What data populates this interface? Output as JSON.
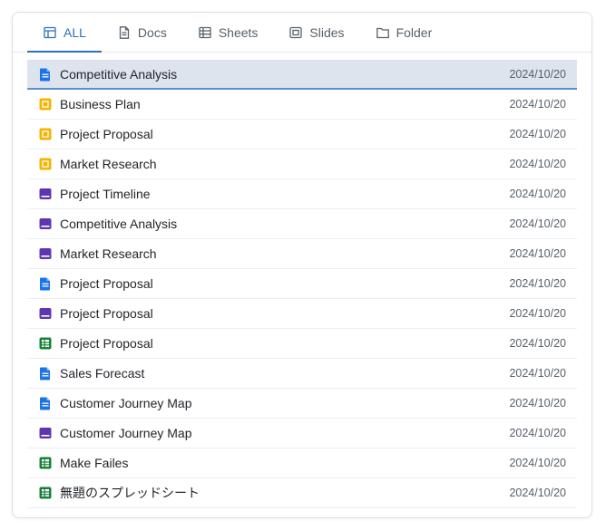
{
  "tabs": [
    {
      "label": "ALL",
      "icon": "layout-icon",
      "active": true
    },
    {
      "label": "Docs",
      "icon": "doc-icon",
      "active": false
    },
    {
      "label": "Sheets",
      "icon": "sheet-icon",
      "active": false
    },
    {
      "label": "Slides",
      "icon": "slides-icon",
      "active": false
    },
    {
      "label": "Folder",
      "icon": "folder-icon",
      "active": false
    }
  ],
  "colors": {
    "accent": "#2c6fbf",
    "doc": "#1a73e8",
    "slides": "#f4b400",
    "purple": "#5e35b1",
    "sheet": "#188038"
  },
  "files": [
    {
      "name": "Competitive Analysis",
      "date": "2024/10/20",
      "type": "doc",
      "selected": true
    },
    {
      "name": "Business Plan",
      "date": "2024/10/20",
      "type": "slides"
    },
    {
      "name": "Project Proposal",
      "date": "2024/10/20",
      "type": "slides"
    },
    {
      "name": "Market Research",
      "date": "2024/10/20",
      "type": "slides"
    },
    {
      "name": "Project Timeline",
      "date": "2024/10/20",
      "type": "purple"
    },
    {
      "name": "Competitive Analysis",
      "date": "2024/10/20",
      "type": "purple"
    },
    {
      "name": "Market Research",
      "date": "2024/10/20",
      "type": "purple"
    },
    {
      "name": "Project Proposal",
      "date": "2024/10/20",
      "type": "doc"
    },
    {
      "name": "Project Proposal",
      "date": "2024/10/20",
      "type": "purple"
    },
    {
      "name": "Project Proposal",
      "date": "2024/10/20",
      "type": "sheet"
    },
    {
      "name": "Sales Forecast",
      "date": "2024/10/20",
      "type": "doc"
    },
    {
      "name": "Customer Journey Map",
      "date": "2024/10/20",
      "type": "doc"
    },
    {
      "name": "Customer Journey Map",
      "date": "2024/10/20",
      "type": "purple"
    },
    {
      "name": "Make Failes",
      "date": "2024/10/20",
      "type": "sheet"
    },
    {
      "name": "無題のスプレッドシート",
      "date": "2024/10/20",
      "type": "sheet"
    }
  ]
}
